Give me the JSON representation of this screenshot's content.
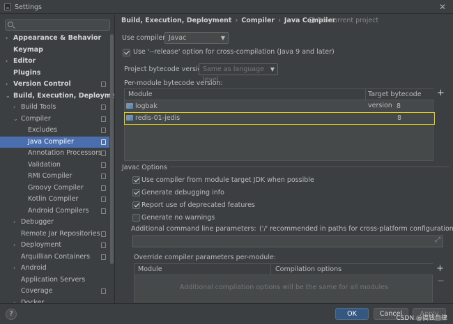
{
  "window": {
    "title": "Settings"
  },
  "sidebar": {
    "search_placeholder": "",
    "items": [
      {
        "label": "Appearance & Behavior"
      },
      {
        "label": "Keymap"
      },
      {
        "label": "Editor"
      },
      {
        "label": "Plugins"
      },
      {
        "label": "Version Control"
      },
      {
        "label": "Build, Execution, Deployment"
      },
      {
        "label": "Build Tools"
      },
      {
        "label": "Compiler"
      },
      {
        "label": "Excludes"
      },
      {
        "label": "Java Compiler"
      },
      {
        "label": "Annotation Processors"
      },
      {
        "label": "Validation"
      },
      {
        "label": "RMI Compiler"
      },
      {
        "label": "Groovy Compiler"
      },
      {
        "label": "Kotlin Compiler"
      },
      {
        "label": "Android Compilers"
      },
      {
        "label": "Debugger"
      },
      {
        "label": "Remote Jar Repositories"
      },
      {
        "label": "Deployment"
      },
      {
        "label": "Arquillian Containers"
      },
      {
        "label": "Android"
      },
      {
        "label": "Application Servers"
      },
      {
        "label": "Coverage"
      },
      {
        "label": "Docker"
      }
    ]
  },
  "breadcrumb": {
    "parts": [
      "Build, Execution, Deployment",
      "Compiler",
      "Java Compiler"
    ],
    "sep": "›",
    "for_project": "For current project"
  },
  "compiler": {
    "label": "Use compiler:",
    "value": "Javac"
  },
  "release_option": {
    "label": "Use '--release' option for cross-compilation (Java 9 and later)",
    "checked": true
  },
  "bytecode": {
    "label": "Project bytecode version:",
    "value": "Same as language level"
  },
  "per_module": {
    "label": "Per-module bytecode version:",
    "columns": [
      "Module",
      "Target bytecode version"
    ],
    "rows": [
      {
        "module": "logbak",
        "version": "8"
      },
      {
        "module": "redis-01-jedis",
        "version": "8"
      }
    ]
  },
  "javac_options": {
    "title": "Javac Options",
    "checks": [
      {
        "label": "Use compiler from module target JDK when possible",
        "checked": true
      },
      {
        "label": "Generate debugging info",
        "checked": true
      },
      {
        "label": "Report use of deprecated features",
        "checked": true
      },
      {
        "label": "Generate no warnings",
        "checked": false
      }
    ],
    "cmd_label": "Additional command line parameters:",
    "cmd_hint": "('/' recommended in paths for cross-platform configurations)",
    "override_label": "Override compiler parameters per-module:",
    "override_columns": [
      "Module",
      "Compilation options"
    ],
    "override_empty": "Additional compilation options will be the same for all modules"
  },
  "footer": {
    "help": "?",
    "ok": "OK",
    "cancel": "Cancel",
    "apply": "Apply",
    "watermark": "CSDN @搞钱自律"
  },
  "icons": {
    "add": "+",
    "remove": "−",
    "expand": "⤢",
    "arrow_right": "›",
    "arrow_down": "⌄",
    "close": "✕"
  }
}
